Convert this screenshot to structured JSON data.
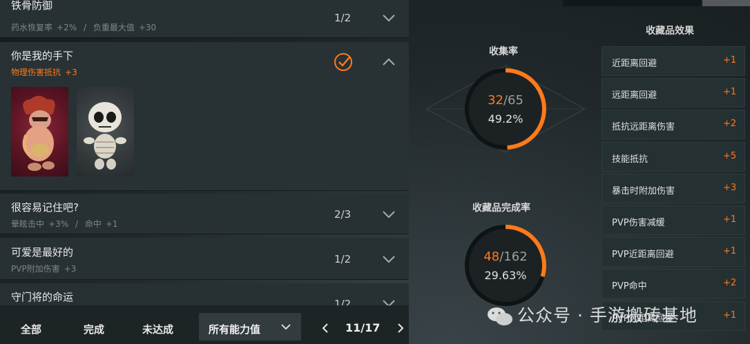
{
  "list": {
    "rows": [
      {
        "title": "铁骨防御",
        "stats": [
          {
            "name": "药水恢复率",
            "value": "+2%"
          },
          {
            "name": "负重最大值",
            "value": "+30"
          }
        ],
        "progress": "1/2"
      },
      {
        "title": "你是我的手下",
        "bonus_name": "物理伤害抵抗",
        "bonus_value": "+3",
        "completed": true
      },
      {
        "title": "很容易记住吧?",
        "stats": [
          {
            "name": "晕眩击中",
            "value": "+3%"
          },
          {
            "name": "命中",
            "value": "+1"
          }
        ],
        "progress": "2/3"
      },
      {
        "title": "可爱是最好的",
        "stats": [
          {
            "name": "PVP附加伤害",
            "value": "+3"
          }
        ],
        "progress": "1/2"
      },
      {
        "title": "守门将的命运",
        "progress": "1/2"
      }
    ],
    "stat_separator": "/"
  },
  "filters": {
    "tabs": [
      "全部",
      "完成",
      "未达成"
    ],
    "active_tab": "全部",
    "dropdown_value": "所有能力值"
  },
  "pager": {
    "label": "11/17",
    "current": 11,
    "total": 17
  },
  "collection": {
    "title": "收集率",
    "current": "32",
    "total": "/65",
    "percent": "49.2%",
    "ratio": 0.492
  },
  "completion": {
    "title": "收藏品完成率",
    "current": "48",
    "total": "/162",
    "percent": "29.63%",
    "ratio": 0.2963
  },
  "effects": {
    "title": "收藏品效果",
    "items": [
      {
        "label": "近距离回避",
        "value": "+1"
      },
      {
        "label": "远距离回避",
        "value": "+1"
      },
      {
        "label": "抵抗远距离伤害",
        "value": "+2"
      },
      {
        "label": "技能抵抗",
        "value": "+5"
      },
      {
        "label": "暴击时附加伤害",
        "value": "+3"
      },
      {
        "label": "PVP伤害减缓",
        "value": "+1"
      },
      {
        "label": "PVP近距离回避",
        "value": "+1"
      },
      {
        "label": "PVP命中",
        "value": "+2"
      },
      {
        "label": "PVP远距离回避",
        "value": "+1"
      }
    ]
  },
  "watermark": "公众号 · 手游搬砖基地",
  "colors": {
    "accent": "#ff7a1a",
    "panel": "#273033",
    "background": "#20282b"
  }
}
